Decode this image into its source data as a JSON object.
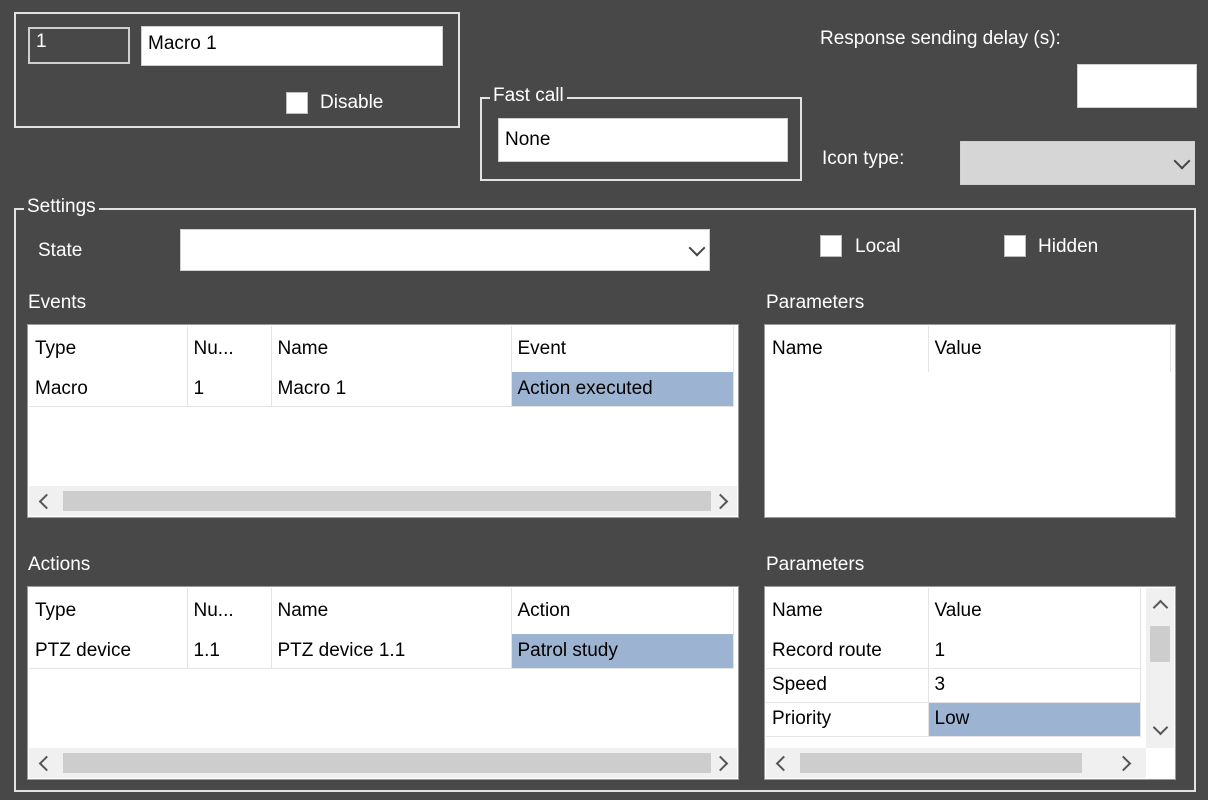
{
  "macro": {
    "number": "1",
    "name": "Macro 1",
    "disable_label": "Disable"
  },
  "fast_call": {
    "legend": "Fast call",
    "value": "None"
  },
  "response": {
    "label": "Response sending delay (s):",
    "value": ""
  },
  "icon_type": {
    "label": "Icon type:",
    "value": ""
  },
  "settings": {
    "legend": "Settings",
    "state_label": "State",
    "state_value": "",
    "local_label": "Local",
    "hidden_label": "Hidden"
  },
  "events": {
    "label": "Events",
    "columns": [
      "Type",
      "Nu...",
      "Name",
      "Event"
    ],
    "rows": [
      [
        "Macro",
        "1",
        "Macro 1",
        "Action executed"
      ]
    ]
  },
  "events_params": {
    "label": "Parameters",
    "columns": [
      "Name",
      "Value"
    ],
    "rows": []
  },
  "actions": {
    "label": "Actions",
    "columns": [
      "Type",
      "Nu...",
      "Name",
      "Action"
    ],
    "rows": [
      [
        "PTZ device",
        "1.1",
        "PTZ device 1.1",
        "Patrol study"
      ]
    ]
  },
  "actions_params": {
    "label": "Parameters",
    "columns": [
      "Name",
      "Value"
    ],
    "rows": [
      [
        "Record route",
        "1"
      ],
      [
        "Speed",
        "3"
      ],
      [
        "Priority",
        "Low"
      ]
    ]
  },
  "colors": {
    "background": "#484848",
    "selection": "#9cb3d1",
    "frame": "#e2e2e2"
  }
}
